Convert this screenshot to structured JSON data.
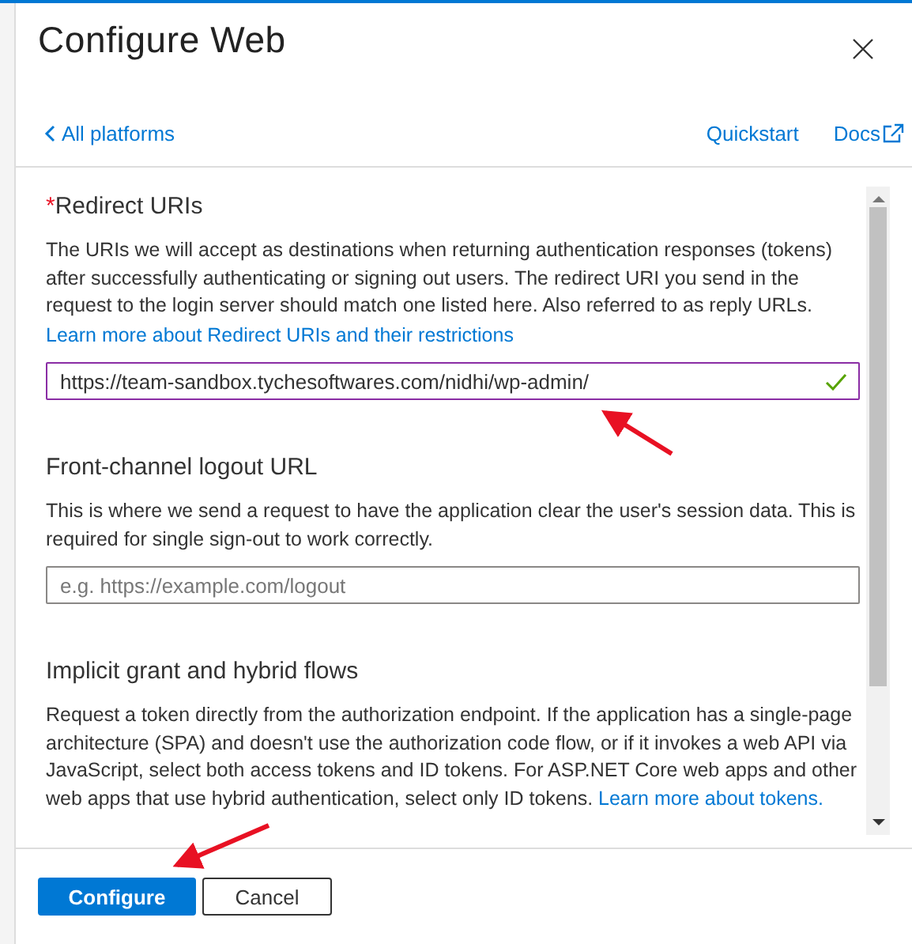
{
  "window": {
    "title": "Configure Web"
  },
  "nav": {
    "back": {
      "label": "All platforms"
    },
    "links": [
      {
        "label": "Quickstart",
        "external": false
      },
      {
        "label": "Docs",
        "external": true
      }
    ]
  },
  "sections": [
    {
      "heading": "Redirect URIs",
      "required_mark": "*",
      "description": "The URIs we will accept as destinations when returning authentication responses (tokens) after successfully authenticating or signing out users. The redirect URI you send in the request to the login server should match one listed here. Also referred to as reply URLs.",
      "footer_link": "Learn more about Redirect URIs and their restrictions",
      "field": {
        "value": "https://team-sandbox.tychesoftwares.com/nidhi/wp-admin/",
        "focused": true,
        "valid": true
      }
    },
    {
      "heading": "Front-channel logout URL",
      "description": "This is where we send a request to have the application clear the user's session data. This is required for single sign-out to work correctly.",
      "field": {
        "placeholder": "e.g. https://example.com/logout",
        "focused": false,
        "valid": false
      }
    },
    {
      "heading": "Implicit grant and hybrid flows",
      "description": "Request a token directly from the authorization endpoint. If the application has a single-page architecture (SPA) and doesn't use the authorization code flow, or if it invokes a web API via JavaScript, select both access tokens and ID tokens. For ASP.NET Core web apps and other web apps that use hybrid authentication, select only ID tokens.",
      "inline_link": "Learn more about tokens."
    }
  ],
  "buttons": [
    {
      "label": "Configure",
      "kind": "primary"
    },
    {
      "label": "Cancel",
      "kind": "secondary"
    }
  ]
}
